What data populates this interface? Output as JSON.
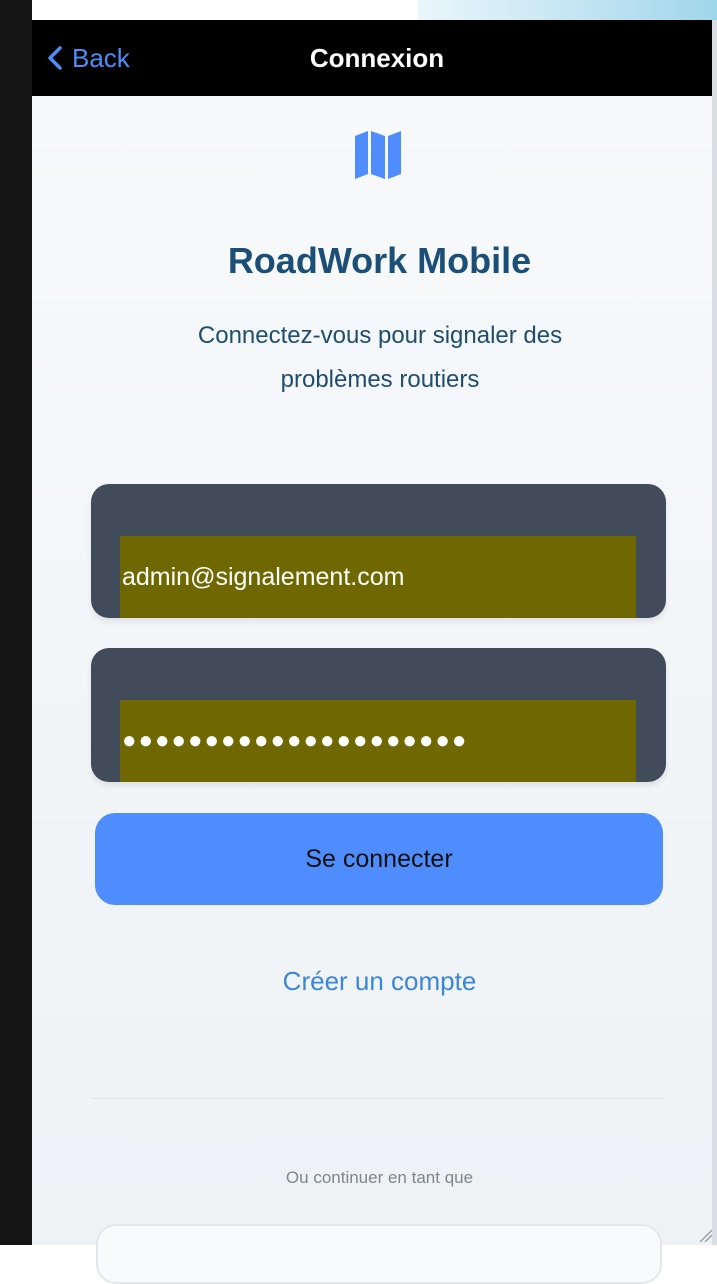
{
  "nav": {
    "back_label": "Back",
    "title": "Connexion"
  },
  "app": {
    "logo_icon": "map-icon",
    "title": "RoadWork Mobile",
    "subtitle": "Connectez-vous pour signaler des problèmes routiers"
  },
  "form": {
    "email_value": "admin@signalement.com",
    "password_value": "●●●●●●●●●●●●●●●●●●●●●",
    "submit_label": "Se connecter"
  },
  "links": {
    "create_account": "Créer un compte"
  },
  "alt": {
    "continue_label": "Ou continuer en tant que"
  },
  "colors": {
    "accent": "#4e8dfb",
    "title": "#1c4f77",
    "field_bg": "#424b5a",
    "autofill_highlight": "#6f6800"
  }
}
